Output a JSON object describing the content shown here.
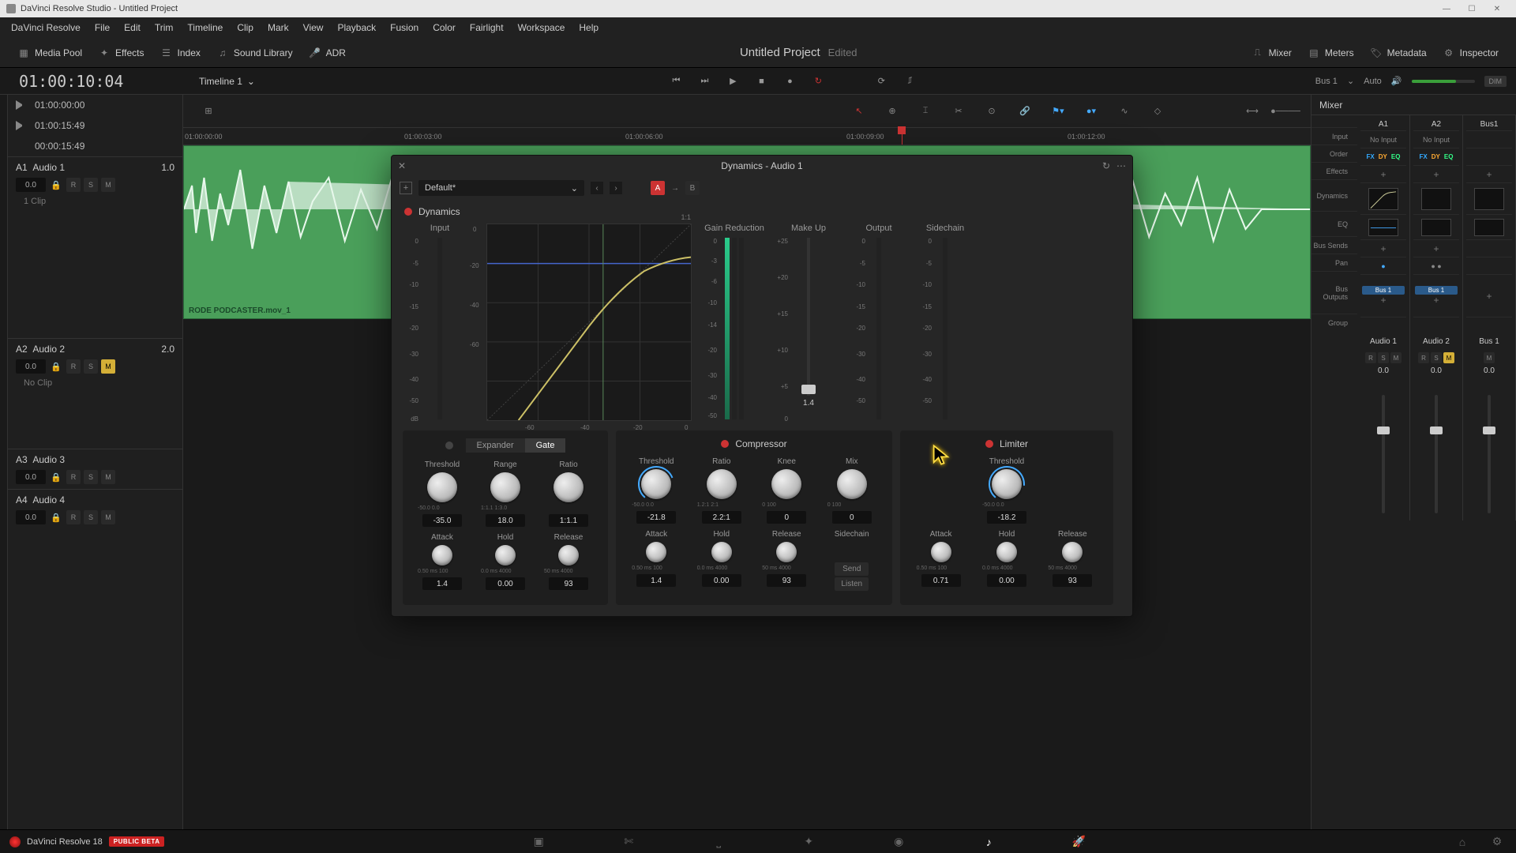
{
  "app": {
    "title": "DaVinci Resolve Studio - Untitled Project",
    "project": "Untitled Project",
    "edited": "Edited",
    "version": "DaVinci Resolve 18",
    "beta": "PUBLIC BETA"
  },
  "menu": [
    "DaVinci Resolve",
    "File",
    "Edit",
    "Trim",
    "Timeline",
    "Clip",
    "Mark",
    "View",
    "Playback",
    "Fusion",
    "Color",
    "Fairlight",
    "Workspace",
    "Help"
  ],
  "toolbar": {
    "media_pool": "Media Pool",
    "effects": "Effects",
    "index": "Index",
    "sound_library": "Sound Library",
    "adr": "ADR",
    "mixer": "Mixer",
    "meters": "Meters",
    "metadata": "Metadata",
    "inspector": "Inspector"
  },
  "timecode": {
    "main": "01:00:10:04",
    "in": "01:00:00:00",
    "out": "01:00:15:49",
    "dur": "00:00:15:49"
  },
  "timeline": {
    "name": "Timeline 1",
    "bus": "Bus 1",
    "auto": "Auto",
    "dim": "DIM"
  },
  "ruler": [
    "01:00:00:00",
    "01:00:03:00",
    "01:00:06:00",
    "01:00:09:00",
    "01:00:12:00"
  ],
  "tracks": [
    {
      "id": "A1",
      "name": "Audio 1",
      "ch": "1.0",
      "vol": "0.0",
      "mute": false,
      "clip": "RODE PODCASTER.mov_1"
    },
    {
      "id": "A2",
      "name": "Audio 2",
      "ch": "2.0",
      "vol": "0.0",
      "mute": true,
      "clip": "No Clip"
    },
    {
      "id": "A3",
      "name": "Audio 3",
      "ch": "",
      "vol": "0.0",
      "mute": false
    },
    {
      "id": "A4",
      "name": "Audio 4",
      "ch": "",
      "vol": "0.0",
      "mute": false
    }
  ],
  "mixer": {
    "title": "Mixer",
    "channels": [
      "A1",
      "A2",
      "Bus1"
    ],
    "input_label": "Input",
    "inputs": [
      "No Input",
      "No Input",
      ""
    ],
    "order_label": "Order",
    "effects_label": "Effects",
    "dynamics_label": "Dynamics",
    "eq_label": "EQ",
    "bus_sends_label": "Bus Sends",
    "pan_label": "Pan",
    "bus_outputs_label": "Bus Outputs",
    "bus_out": "Bus 1",
    "group_label": "Group",
    "ch_names": [
      "Audio 1",
      "Audio 2",
      "Bus 1"
    ],
    "db": [
      "0.0",
      "0.0",
      "0.0"
    ]
  },
  "modal": {
    "title": "Dynamics - Audio 1",
    "preset": "Default*",
    "section": "Dynamics",
    "labels": {
      "input": "Input",
      "gr": "Gain Reduction",
      "makeup": "Make Up",
      "output": "Output",
      "sidechain": "Sidechain",
      "ratio11": "1:1"
    },
    "input_ticks": [
      "0",
      "-5",
      "-10",
      "-15",
      "-20",
      "-30",
      "-40",
      "-50",
      "dB"
    ],
    "gr_ticks": [
      "0",
      "-3",
      "-6",
      "-10",
      "-14",
      "-20",
      "-30",
      "-40",
      "-50"
    ],
    "makeup_ticks": [
      "+25",
      "+20",
      "+15",
      "+10",
      "+5",
      "0"
    ],
    "out_ticks": [
      "0",
      "-5",
      "-10",
      "-15",
      "-20",
      "-30",
      "-40",
      "-50"
    ],
    "graph_x": [
      "-60",
      "-40",
      "-20",
      "0"
    ],
    "graph_y": [
      "0",
      "-20",
      "-40",
      "-60"
    ],
    "makeup_val": "1.4"
  },
  "expgate": {
    "expander": "Expander",
    "gate": "Gate",
    "threshold_label": "Threshold",
    "threshold_ticks": "-50.0  0.0",
    "threshold": "-35.0",
    "range_label": "Range",
    "range_ticks": "1:1.1  1:3.0",
    "range": "18.0",
    "ratio_label": "Ratio",
    "ratio_ticks": "",
    "ratio": "1:1.1",
    "attack_label": "Attack",
    "attack_ticks": "0.50  ms  100",
    "attack": "1.4",
    "hold_label": "Hold",
    "hold_ticks": "0.0  ms  4000",
    "hold": "0.00",
    "release_label": "Release",
    "release_ticks": "50  ms  4000",
    "release": "93"
  },
  "comp": {
    "title": "Compressor",
    "threshold_label": "Threshold",
    "threshold_ticks": "-50.0  0.0",
    "threshold": "-21.8",
    "ratio_label": "Ratio",
    "ratio_ticks": "1.2:1  2:1",
    "ratio": "2.2:1",
    "knee_label": "Knee",
    "knee_ticks": "0    100",
    "knee": "0",
    "mix_label": "Mix",
    "mix_ticks": "0    100",
    "mix": "0",
    "attack_label": "Attack",
    "attack_ticks": "0.50  ms  100",
    "attack": "1.4",
    "hold_label": "Hold",
    "hold_ticks": "0.0  ms  4000",
    "hold": "0.00",
    "release_label": "Release",
    "release_ticks": "50  ms  4000",
    "release": "93",
    "sidechain_label": "Sidechain",
    "send": "Send",
    "listen": "Listen"
  },
  "lim": {
    "title": "Limiter",
    "threshold_label": "Threshold",
    "threshold_ticks": "-50.0  0.0",
    "threshold": "-18.2",
    "attack_label": "Attack",
    "attack_ticks": "0.50  ms  100",
    "attack": "0.71",
    "hold_label": "Hold",
    "hold_ticks": "0.0  ms  4000",
    "hold": "0.00",
    "release_label": "Release",
    "release_ticks": "50  ms  4000",
    "release": "93"
  }
}
